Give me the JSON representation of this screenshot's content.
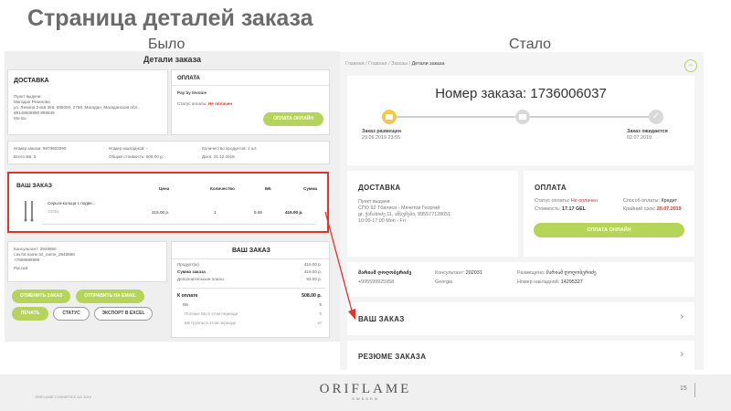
{
  "slide": {
    "title": "Страница деталей заказа",
    "before_label": "Было",
    "after_label": "Стало",
    "page_number": "15",
    "footer_small": "ORIFLAME COSMETICS AG 2019",
    "logo_main": "ORIFLAME",
    "logo_sub": "SWEDEN",
    "highlight_color": "#e0342c",
    "accent_green": "#b6d35a"
  },
  "old": {
    "page_title": "Детали заказа",
    "delivery": {
      "title": "ДОСТАВКА",
      "lines": [
        "Пункт выдачи",
        "Магадан Резинова",
        "ул. Ленина 3 кв6 356, 685000, 2768, Магадан, Магаданская обл.,",
        "89148606890 898849",
        "Mo-Su"
      ]
    },
    "payment": {
      "title": "ОПЛАТА",
      "method": "Pay by Invoice",
      "status_label": "Статус оплаты:",
      "status_value": "Не оплачен",
      "pay_button": "ОПЛАТА ОНЛАЙН"
    },
    "info": {
      "order_number": "Номер заказа: 9973602090",
      "total_bb": "Всего ББ: 5",
      "invoice_number": "Номер накладной: -",
      "total_cost": "Общая стоимость: 508.00 р.",
      "product_count": "Количество продуктов: 1 шт.",
      "date": "Дата: 21.12.2018"
    },
    "your_order": {
      "title": "ВАШ ЗАКАЗ",
      "columns": [
        "Цена",
        "Количество",
        "ББ",
        "Сумма"
      ],
      "item_name": "Серьги-кольца с подве...",
      "item_code": "33551",
      "price": "415.00 р.",
      "qty": "1",
      "bb": "5.55",
      "sum": "415.00 р."
    },
    "consultant": {
      "lines": [
        "Консультант: 2848866",
        "r.av.fot.name.txt_name_2848866",
        "+7898989999",
        "Россия"
      ]
    },
    "buttons": {
      "cancel": "ОТМЕНИТЬ ЗАКАЗ",
      "send": "ОТПРАВИТЬ НА EMAIL",
      "print": "ПЕЧАТЬ",
      "status": "СТАТУС",
      "export": "ЭКСПОРТ В EXCEL"
    },
    "summary": {
      "title": "ВАШ ЗАКАЗ",
      "rows": [
        {
          "label": "Продукт(ы)",
          "value": "415.00 р."
        },
        {
          "label": "Сумма заказа",
          "value": "415.00 р."
        },
        {
          "label": "Дополнительные платы",
          "value": "93.00 р."
        }
      ],
      "total_label": "К оплате",
      "total_value": "508.00 р.",
      "bb_label": "ББ",
      "bb_value": "5",
      "sub_rows": [
        {
          "label": "Полные ББ в этом периоде",
          "value": "5"
        },
        {
          "label": "ББ группы в этом периоде",
          "value": "10"
        }
      ]
    }
  },
  "new": {
    "breadcrumb": [
      "Главная",
      "Главная",
      "Заказы",
      "Детали заказа"
    ],
    "order_title": "Номер заказа: 1736006037",
    "steps": [
      {
        "label": "Заказ размещен",
        "date": "29.06.2019 23:55"
      },
      {
        "label": "",
        "date": ""
      },
      {
        "label": "Заказ ожидается",
        "date": "02.07.2019"
      }
    ],
    "delivery": {
      "title": "ДОСТАВКА",
      "lines": [
        "Пункт выдачи",
        "СПО 92 Тбилиси - Мечетов Георгий",
        "gr. ქაჩახიძე 11, ანსუმები, 995577128051",
        "10:00-17:00 Mon - Fri"
      ]
    },
    "payment": {
      "title": "ОПЛАТА",
      "status_label": "Статус оплаты:",
      "status_value": "Не оплачен",
      "cost_label": "Стоимость:",
      "cost_value": "17.17 GEL",
      "method_label": "Способ оплаты:",
      "method_value": "Кредит",
      "deadline_label": "Крайний срок:",
      "deadline_value": "20.07.2019",
      "pay_button": "ОПЛАТА ОНЛАЙН"
    },
    "consultant": {
      "name": "მარიამ ღოღობერიძე",
      "phone": "+995599925958",
      "consultant_label": "Консультант:",
      "consultant_value": "202031",
      "country": "Georgia",
      "placed_label": "Размещено:",
      "placed_value": "მარიამ ღოღობერიძე",
      "invoice_label": "Номер накладной:",
      "invoice_value": "14295327"
    },
    "sections": [
      "ВАШ ЗАКАЗ",
      "РЕЗЮМЕ ЗАКАЗА"
    ]
  }
}
